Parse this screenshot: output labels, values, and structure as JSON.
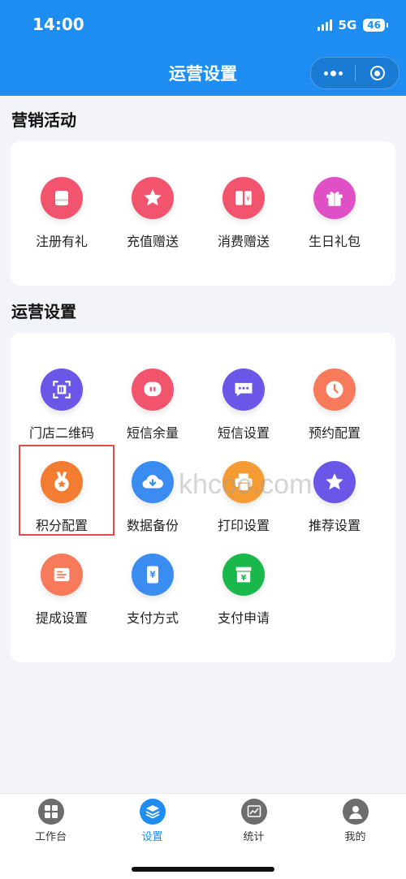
{
  "status_bar": {
    "time": "14:00",
    "network": "5G",
    "battery": "46"
  },
  "header": {
    "title": "运营设置"
  },
  "marketing": {
    "title": "营销活动",
    "items": [
      {
        "label": "注册有礼",
        "icon": "gift-card-icon",
        "color": "#f2546e"
      },
      {
        "label": "充值赠送",
        "icon": "star-icon",
        "color": "#f2546e"
      },
      {
        "label": "消费赠送",
        "icon": "ticket-icon",
        "color": "#f2546e"
      },
      {
        "label": "生日礼包",
        "icon": "gift-box-icon",
        "color": "#df4fc6"
      }
    ]
  },
  "operations": {
    "title": "运营设置",
    "items": [
      {
        "label": "门店二维码",
        "icon": "qr-scan-icon",
        "color": "#6a57e8"
      },
      {
        "label": "短信余量",
        "icon": "sms-bubble-icon",
        "color": "#f2546e"
      },
      {
        "label": "短信设置",
        "icon": "message-icon",
        "color": "#6a57e8"
      },
      {
        "label": "预约配置",
        "icon": "clock-icon",
        "color": "#f77a5a"
      },
      {
        "label": "积分配置",
        "icon": "medal-icon",
        "color": "#f37c33",
        "selected": true
      },
      {
        "label": "数据备份",
        "icon": "cloud-download-icon",
        "color": "#3a8cf0"
      },
      {
        "label": "打印设置",
        "icon": "printer-icon",
        "color": "#f59b33"
      },
      {
        "label": "推荐设置",
        "icon": "star-icon",
        "color": "#6a57e8"
      },
      {
        "label": "提成设置",
        "icon": "document-icon",
        "color": "#f77a5a"
      },
      {
        "label": "支付方式",
        "icon": "yen-card-icon",
        "color": "#3a8cf0"
      },
      {
        "label": "支付申请",
        "icon": "yen-box-icon",
        "color": "#18b84a"
      }
    ]
  },
  "watermark": "khcoo.com",
  "tabbar": [
    {
      "label": "工作台",
      "icon": "grid-icon",
      "active": false
    },
    {
      "label": "设置",
      "icon": "layers-icon",
      "active": true
    },
    {
      "label": "统计",
      "icon": "chart-icon",
      "active": false
    },
    {
      "label": "我的",
      "icon": "user-icon",
      "active": false
    }
  ],
  "colors": {
    "brand": "#1e8df2",
    "background": "#f3f4f7",
    "selection": "#e04b4b"
  }
}
